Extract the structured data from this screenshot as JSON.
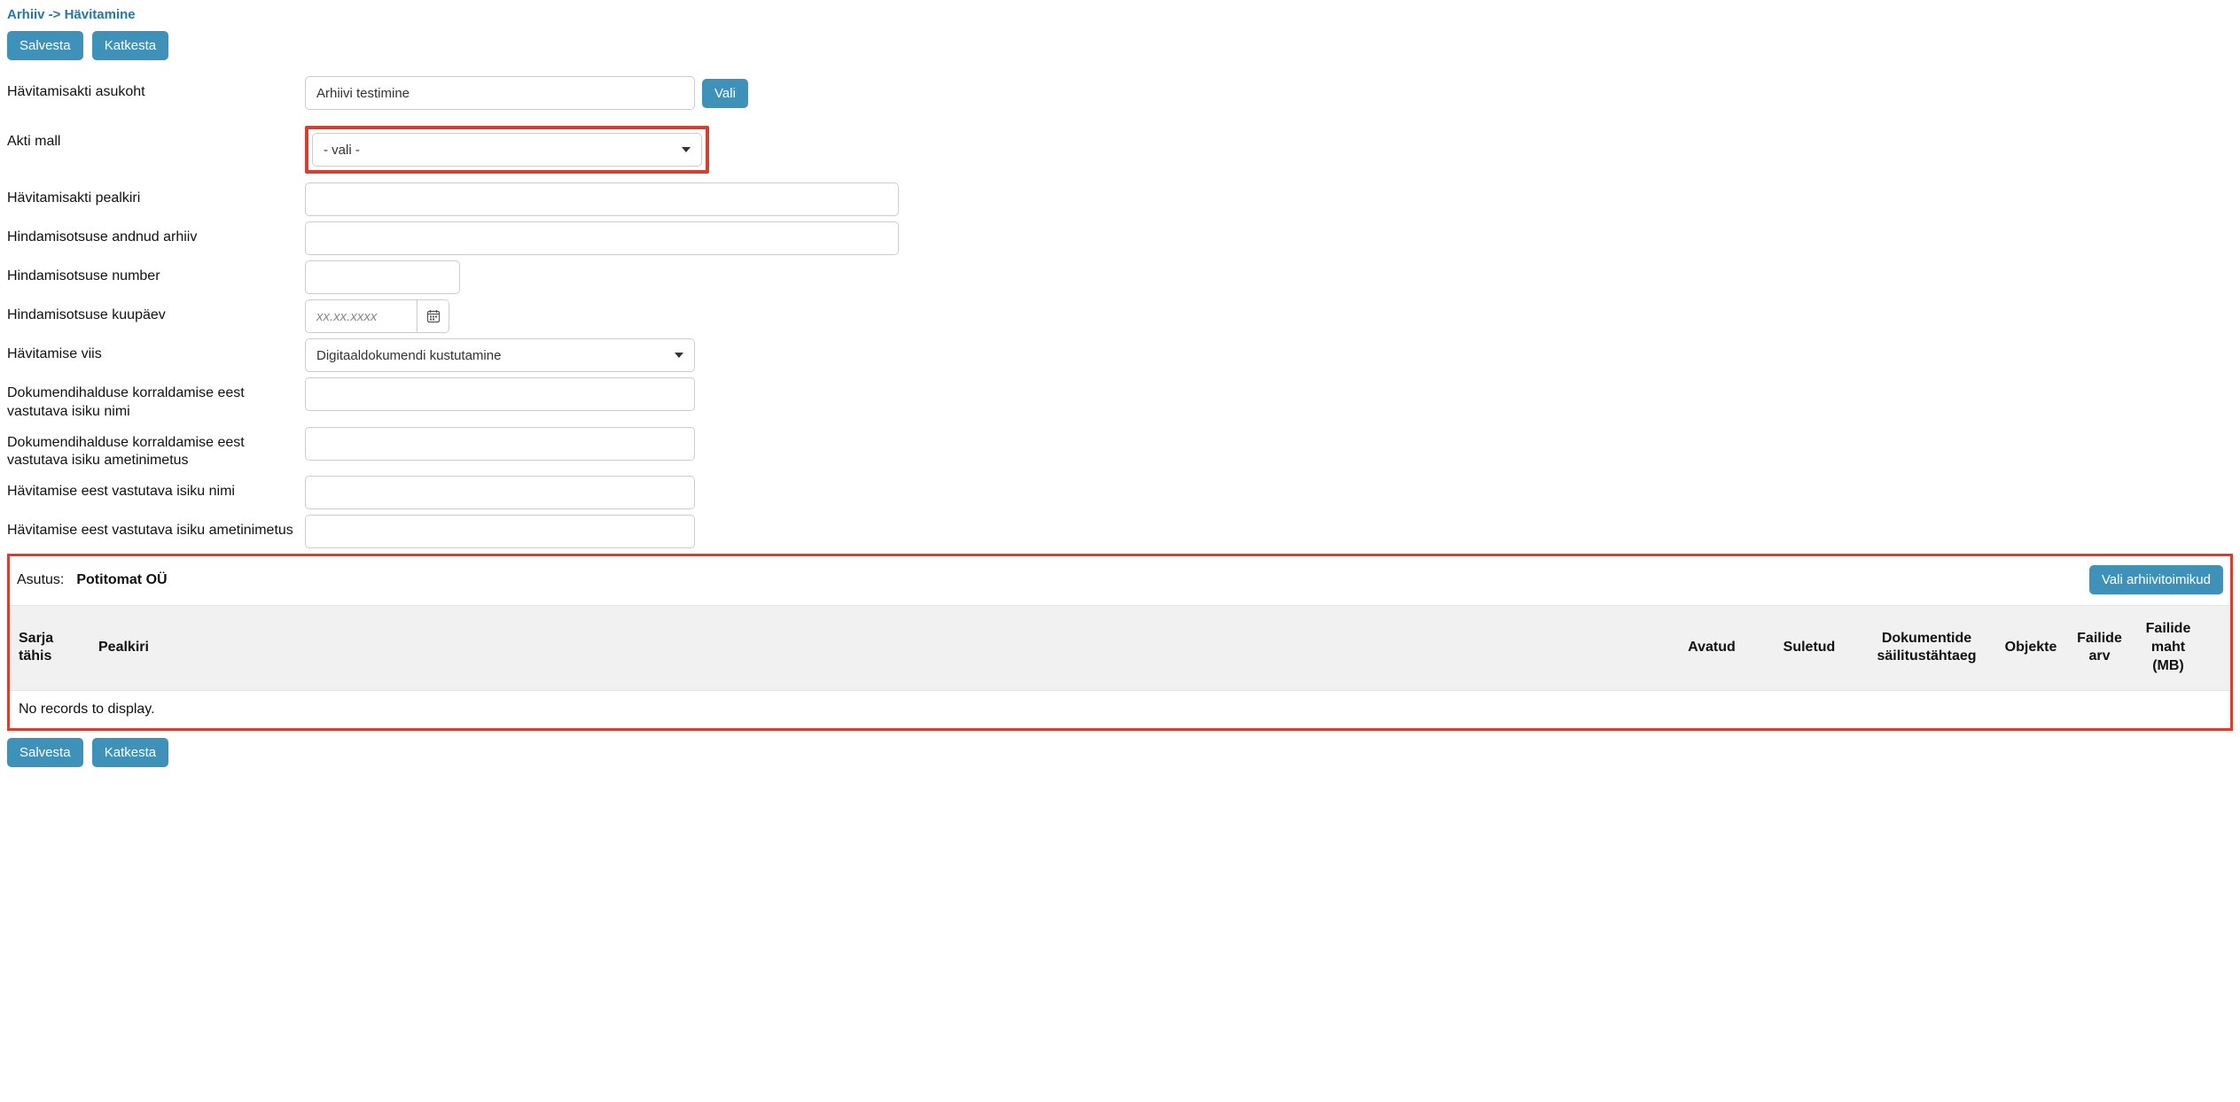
{
  "breadcrumb": "Arhiiv -> Hävitamine",
  "buttons": {
    "save": "Salvesta",
    "cancel": "Katkesta",
    "vali": "Vali",
    "vali_arhiivitoimikud": "Vali arhiivitoimikud"
  },
  "form": {
    "asukoht": {
      "label": "Hävitamisakti asukoht",
      "value": "Arhiivi testimine"
    },
    "mall": {
      "label": "Akti mall",
      "placeholder": "- vali -",
      "value": "- vali -"
    },
    "pealkiri": {
      "label": "Hävitamisakti pealkiri",
      "value": ""
    },
    "arhiiv": {
      "label": "Hindamisotsuse andnud arhiiv",
      "value": ""
    },
    "number": {
      "label": "Hindamisotsuse number",
      "value": ""
    },
    "kuupaev": {
      "label": "Hindamisotsuse kuupäev",
      "placeholder": "xx.xx.xxxx",
      "value": ""
    },
    "viis": {
      "label": "Hävitamise viis",
      "value": "Digitaaldokumendi kustutamine"
    },
    "dok_nimi": {
      "label": "Dokumendihalduse korraldamise eest vastutava isiku nimi",
      "value": ""
    },
    "dok_amet": {
      "label": "Dokumendihalduse korraldamise eest vastutava isiku ametinimetus",
      "value": ""
    },
    "hav_nimi": {
      "label": "Hävitamise eest vastutava isiku nimi",
      "value": ""
    },
    "hav_amet": {
      "label": "Hävitamise eest vastutava isiku ametinimetus",
      "value": ""
    }
  },
  "table_section": {
    "asutus_label": "Asutus:",
    "asutus_value": "Potitomat OÜ",
    "columns": {
      "sarja": "Sarja tähis",
      "pealkiri": "Pealkiri",
      "avatud": "Avatud",
      "suletud": "Suletud",
      "sailitus": "Dokumentide säilitustähtaeg",
      "objekte": "Objekte",
      "failide_arv": "Failide arv",
      "failide_maht": "Failide maht (MB)"
    },
    "empty": "No records to display."
  }
}
